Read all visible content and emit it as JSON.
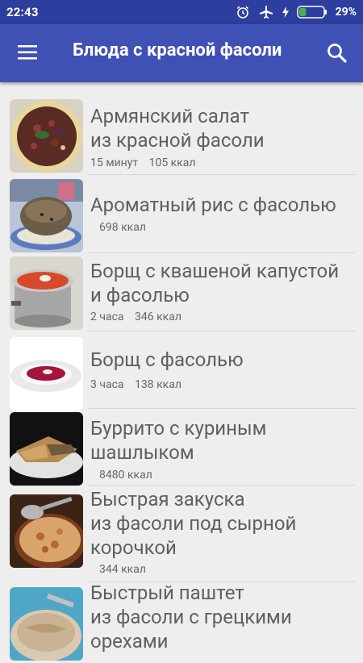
{
  "status": {
    "time": "22:43",
    "battery_percent": "29%",
    "battery_level": 0.29,
    "icons": [
      "alarm-icon",
      "airplane-icon",
      "charging-icon",
      "battery-icon"
    ]
  },
  "app_bar": {
    "title": "Блюда с красной фасоли",
    "menu_icon": "hamburger-menu-icon",
    "search_icon": "search-icon"
  },
  "colors": {
    "status_bar": "#2e3e9e",
    "app_bar": "#3f51b5",
    "background": "#eeeeee",
    "title_text": "#5f5f5f",
    "battery_fill": "#4caf50"
  },
  "recipes": [
    {
      "title_lines": [
        "Армянский салат",
        "из красной фасоли"
      ],
      "time": "15 минут",
      "kcal": "105 ккал"
    },
    {
      "title_lines": [
        "Ароматный рис с фасолью"
      ],
      "time": "",
      "kcal": "698 ккал"
    },
    {
      "title_lines": [
        "Борщ с квашеной капустой",
        "и фасолью"
      ],
      "time": "2 часа",
      "kcal": "346 ккал"
    },
    {
      "title_lines": [
        "Борщ с фасолью"
      ],
      "time": "3 часа",
      "kcal": "138 ккал"
    },
    {
      "title_lines": [
        "Буррито с куриным",
        "шашлыком"
      ],
      "time": "",
      "kcal": "8480 ккал"
    },
    {
      "title_lines": [
        "Быстрая закуска",
        "из фасоли под сырной",
        "корочкой"
      ],
      "time": "",
      "kcal": "344 ккал"
    },
    {
      "title_lines": [
        "Быстрый паштет",
        "из фасоли с грецкими",
        "орехами"
      ],
      "time": "",
      "kcal": ""
    }
  ]
}
